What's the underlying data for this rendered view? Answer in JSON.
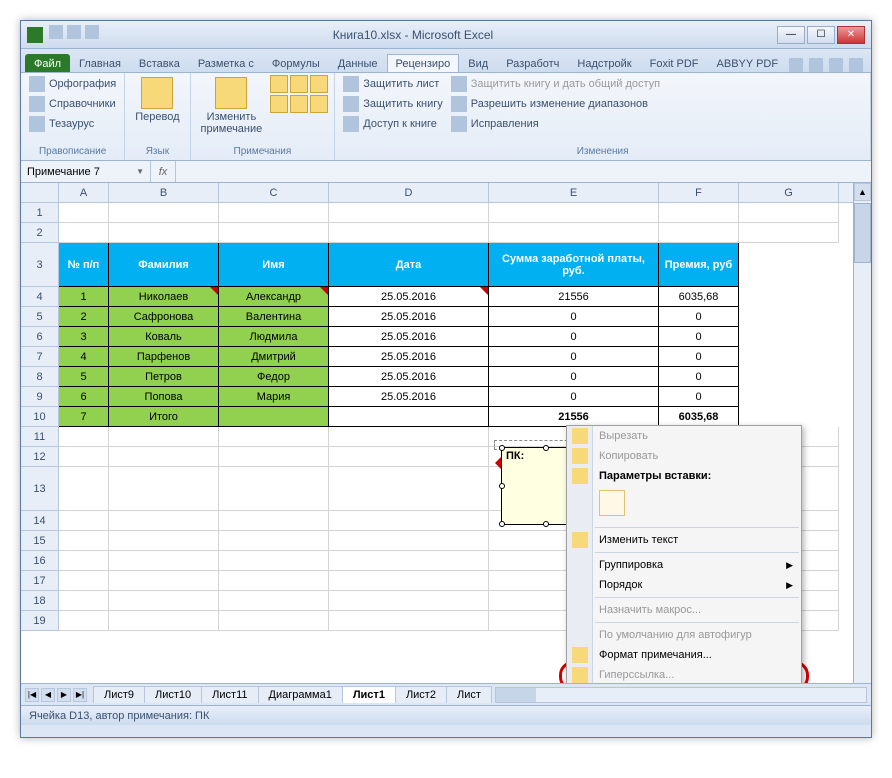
{
  "window": {
    "title": "Книга10.xlsx - Microsoft Excel"
  },
  "tabs": {
    "file": "Файл",
    "items": [
      "Главная",
      "Вставка",
      "Разметка с",
      "Формулы",
      "Данные",
      "Рецензиро",
      "Вид",
      "Разработч",
      "Надстройк",
      "Foxit PDF",
      "ABBYY PDF"
    ],
    "active_index": 5
  },
  "ribbon": {
    "proofing": {
      "label": "Правописание",
      "spelling": "Орфография",
      "research": "Справочники",
      "thesaurus": "Тезаурус"
    },
    "language": {
      "label": "Язык",
      "translate": "Перевод"
    },
    "comments": {
      "label": "Примечания",
      "edit": "Изменить\nпримечание"
    },
    "changes": {
      "label": "Изменения",
      "protect_sheet": "Защитить лист",
      "protect_book": "Защитить книгу",
      "share_book": "Доступ к книге",
      "protect_share": "Защитить книгу и дать общий доступ",
      "allow_ranges": "Разрешить изменение диапазонов",
      "track": "Исправления"
    }
  },
  "namebox": "Примечание 7",
  "columns": [
    "A",
    "B",
    "C",
    "D",
    "E",
    "F",
    "G"
  ],
  "rows_blank_top": [
    1,
    2
  ],
  "header_row_num": 3,
  "header": [
    "№ п/п",
    "Фамилия",
    "Имя",
    "Дата",
    "Сумма заработной платы, руб.",
    "Премия, руб"
  ],
  "data_rows": [
    {
      "n": 4,
      "cells": [
        "1",
        "Николаев",
        "Александр",
        "25.05.2016",
        "21556",
        "6035,68"
      ]
    },
    {
      "n": 5,
      "cells": [
        "2",
        "Сафронова",
        "Валентина",
        "25.05.2016",
        "0",
        "0"
      ]
    },
    {
      "n": 6,
      "cells": [
        "3",
        "Коваль",
        "Людмила",
        "25.05.2016",
        "0",
        "0"
      ]
    },
    {
      "n": 7,
      "cells": [
        "4",
        "Парфенов",
        "Дмитрий",
        "25.05.2016",
        "0",
        "0"
      ]
    },
    {
      "n": 8,
      "cells": [
        "5",
        "Петров",
        "Федор",
        "25.05.2016",
        "0",
        "0"
      ]
    },
    {
      "n": 9,
      "cells": [
        "6",
        "Попова",
        "Мария",
        "25.05.2016",
        "0",
        "0"
      ]
    }
  ],
  "total_row": {
    "n": 10,
    "cells": [
      "7",
      "Итого",
      "",
      "",
      "21556",
      "6035,68"
    ]
  },
  "blank_rows": [
    11,
    12,
    13,
    14,
    15,
    16,
    17,
    18,
    19
  ],
  "comment": {
    "author": "ПК:"
  },
  "context_menu": {
    "cut": "Вырезать",
    "copy": "Копировать",
    "paste_opts": "Параметры вставки:",
    "edit_text": "Изменить текст",
    "group": "Группировка",
    "order": "Порядок",
    "assign_macro": "Назначить макрос...",
    "default_autoshape": "По умолчанию для автофигур",
    "format_comment": "Формат примечания...",
    "hyperlink": "Гиперссылка..."
  },
  "sheet_tabs": [
    "Лист9",
    "Лист10",
    "Лист11",
    "Диаграмма1",
    "Лист1",
    "Лист2",
    "Лист"
  ],
  "sheet_active_index": 4,
  "status": "Ячейка D13, автор примечания: ПК"
}
